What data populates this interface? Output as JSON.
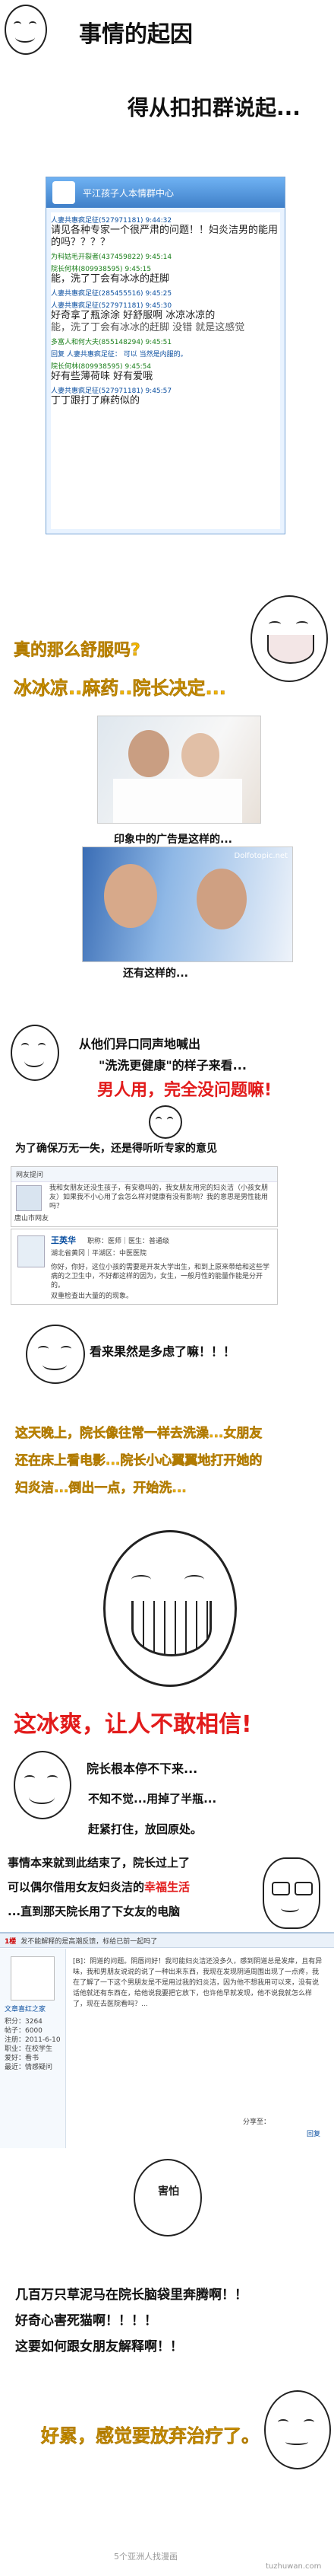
{
  "intro": {
    "line1": "事情的起因",
    "line2": "得从扣扣群说起..."
  },
  "chat": {
    "title": "平江孩子人本情群中心",
    "messages": [
      {
        "sender": "人妻共惠疯足征(527971181)",
        "time": "9:44:32",
        "text": "请见各种专家一个很严肃的问题！！妇炎洁男的能用的吗？？？？"
      },
      {
        "sender": "为科姑毛开裂者(437459822)",
        "time": "9:45:14",
        "text": ""
      },
      {
        "sender": "院长何林(809938595)",
        "time": "9:45:15",
        "text": "能，洗了丁会有冰冰的赶脚"
      },
      {
        "sender": "人妻共惠疯足征(285455516)",
        "time": "9:45:25",
        "text": ""
      },
      {
        "sender": "人妻共惠疯足征(527971181)",
        "time": "9:45:30",
        "text": "好奇拿了瓶涂涂 好舒服啊 冰凉冰凉的"
      },
      {
        "sender": "",
        "time": "",
        "text": "能，洗了丁会有冰冰的赶脚 没错 就是这感觉"
      },
      {
        "sender": "多富人和何大夫(855148294)",
        "time": "9:45:51",
        "text": ""
      },
      {
        "sender": "回复 人妻共惠疯足征：",
        "time": "",
        "text": "可以 当然是内服的。"
      },
      {
        "sender": "院长何林(809938595)",
        "time": "9:45:54",
        "text": "好有些薄荷味 好有爱哦"
      },
      {
        "sender": "人妻共惠疯足征(527971181)",
        "time": "9:45:57",
        "text": "丁丁跟打了麻药似的"
      }
    ]
  },
  "reaction1": {
    "line1": "真的那么舒服吗?",
    "line2": "冰冰凉..麻药..院长决定..."
  },
  "ads": {
    "caption1": "印象中的广告是这样的...",
    "caption2": "还有这样的...",
    "watermark": "Dolfotopic.net"
  },
  "section2": {
    "line1": "从他们异口同声地喊出",
    "line2": "\"洗洗更健康\"的样子来看...",
    "line3": "男人用，完全没问题嘛!"
  },
  "section3": {
    "line1": "为了确保万无一失，还是得听听专家的意见"
  },
  "expert": {
    "header": "网友提问",
    "question": "我和女朋友还没生孩子，有安稳吗的，我女朋友用完的妇炎洁（小孩女朋友）如果我不小心用了会怎么样对健康有没有影响？我的意思是男性能用吗？",
    "asker": "唐山市网友",
    "doctor_name": "王英华",
    "doctor_title": "职称：医师｜医生：普通级",
    "doctor_org": "湖北省黄冈｜平湖区：中医医院",
    "answer": "你好，你好，这位小孩的需要是开发大学出生，和到上原来带给和这些学病的之卫生中，不好都这样的因为，女生，一般月性的能量作能是分开的。",
    "answer2": "双重检查出大量的的现象。"
  },
  "section4": {
    "line1": "看来果然是多虑了嘛！！！"
  },
  "section5": {
    "line1": "这天晚上，院长像往常一样去洗澡...女朋友",
    "line2": "还在床上看电影...院长小心翼翼地打开她的",
    "line3": "妇炎洁...倒出一点，开始洗..."
  },
  "section6": {
    "line1": "这冰爽，让人不敢相信!"
  },
  "section7": {
    "line1": "院长根本停不下来...",
    "line2": "不知不觉...用掉了半瓶...",
    "line3": "赶紧打住，放回原处。"
  },
  "section8": {
    "line1": "事情本来就到此结束了，院长过上了",
    "line2a": "可以偶尔借用女友妇炎洁的",
    "line2b": "幸福生活",
    "line3": "...直到那天院长用了下女友的电脑"
  },
  "forum": {
    "floor": "1楼",
    "header_text": "发不能解释的是高潮反馈，标给已前一起吗了",
    "user": "文章喜红之家",
    "user_meta": [
      "积分：3264",
      "帖子：6000",
      "注册：2011-6-10",
      "职业：在校学生",
      "爱好：看书",
      "最近：情感疑问"
    ],
    "post": "[B]：阴道的问题。阴唇问好！我可能妇炎洁还没多久，感到阴道总是发痒，且有异味，我和男朋友说说的说了一种出来东西，我现在发现阴道周围出现了一点疼，我在了解了一下这个男朋友是不是用过我的妇炎洁，因为他不想我用可以来，没有说话他就还有东西在，给他说我要把它放下，也许他早就发现，他不说我就怎么样了，现在去医院看吗？...",
    "reply_label": "分享至：",
    "footer_link": "回复"
  },
  "section9": {
    "fear_label": "害怕",
    "line1": "几百万只草泥马在院长脑袋里奔腾啊！！",
    "line2": "好奇心害死猫啊！！！！",
    "line3": "这要如何跟女朋友解释啊！！"
  },
  "ending": {
    "line1": "好累，感觉要放弃治疗了。"
  },
  "watermark": {
    "center": "5个亚洲人找漫画",
    "corner": "tuzhuwan.com"
  },
  "colors": {
    "yellow": "#f2b600",
    "red": "#e21b1b",
    "black": "#111111",
    "chat_border": "#7aa6d6"
  }
}
